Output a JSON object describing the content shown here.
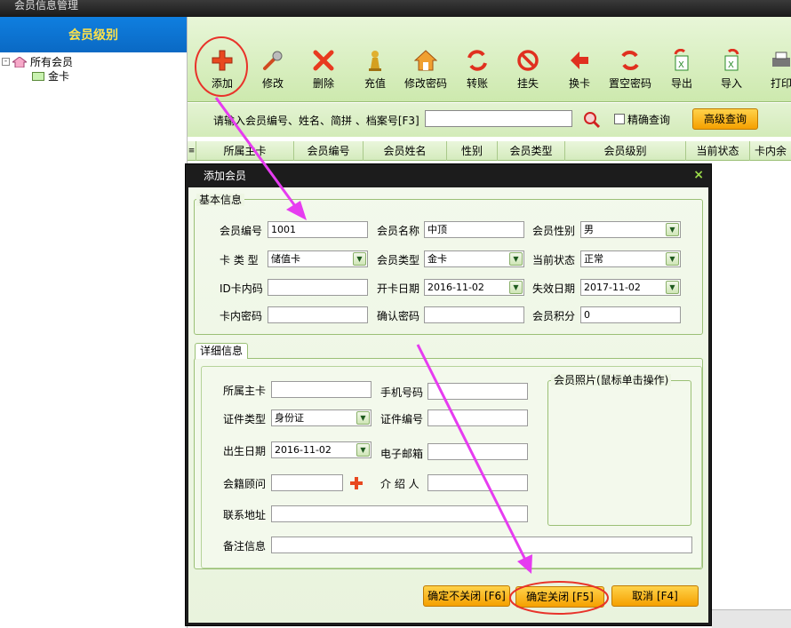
{
  "window": {
    "title": "会员信息管理"
  },
  "sidebar": {
    "header": "会员级别",
    "tree": [
      {
        "label": "所有会员",
        "expander": "-"
      },
      {
        "label": "金卡"
      }
    ]
  },
  "toolbar": {
    "buttons": [
      {
        "label": "添加",
        "icon": "plus-icon"
      },
      {
        "label": "修改",
        "icon": "wrench-icon"
      },
      {
        "label": "删除",
        "icon": "x-icon"
      },
      {
        "label": "充值",
        "icon": "pawn-icon"
      },
      {
        "label": "修改密码",
        "icon": "house-icon"
      },
      {
        "label": "转账",
        "icon": "transfer-icon"
      },
      {
        "label": "挂失",
        "icon": "ban-icon"
      },
      {
        "label": "换卡",
        "icon": "swap-icon"
      },
      {
        "label": "置空密码",
        "icon": "reset-icon"
      },
      {
        "label": "导出",
        "icon": "export-icon"
      },
      {
        "label": "导入",
        "icon": "import-icon"
      },
      {
        "label": "打印",
        "icon": "printer-icon"
      }
    ]
  },
  "search": {
    "label": "请输入会员编号、姓名、简拼 、档案号[F3]",
    "value": "",
    "exact_label": "精确查询",
    "advanced_label": "高级查询"
  },
  "grid": {
    "columns": [
      "所属主卡",
      "会员编号",
      "会员姓名",
      "性别",
      "会员类型",
      "会员级别",
      "当前状态",
      "卡内余"
    ]
  },
  "dialog": {
    "title": "添加会员",
    "close": "×",
    "basic": {
      "legend": "基本信息",
      "member_no_label": "会员编号",
      "member_no": "1001",
      "member_name_label": "会员名称",
      "member_name": "中顶",
      "gender_label": "会员性别",
      "gender": "男",
      "card_type_label": "卡 类 型",
      "card_type": "储值卡",
      "member_type_label": "会员类型",
      "member_type": "金卡",
      "status_label": "当前状态",
      "status": "正常",
      "id_code_label": "ID卡内码",
      "id_code": "",
      "open_date_label": "开卡日期",
      "open_date": "2016-11-02",
      "expire_label": "失效日期",
      "expire": "2017-11-02",
      "card_pwd_label": "卡内密码",
      "card_pwd": "",
      "confirm_pwd_label": "确认密码",
      "confirm_pwd": "",
      "points_label": "会员积分",
      "points": "0"
    },
    "detail": {
      "tab": "详细信息",
      "main_card_label": "所属主卡",
      "main_card": "",
      "phone_label": "手机号码",
      "phone": "",
      "id_type_label": "证件类型",
      "id_type": "身份证",
      "id_no_label": "证件编号",
      "id_no": "",
      "birth_label": "出生日期",
      "birth": "2016-11-02",
      "email_label": "电子邮箱",
      "email": "",
      "advisor_label": "会籍顾问",
      "advisor": "",
      "referrer_label": "介 绍 人",
      "referrer": "",
      "address_label": "联系地址",
      "address": "",
      "remark_label": "备注信息",
      "remark": "",
      "photo_legend": "会员照片(鼠标单击操作)"
    },
    "buttons": {
      "save_keep": "确定不关闭 [F6]",
      "save_close": "确定关闭 [F5]",
      "cancel": "取消 [F4]"
    }
  },
  "colors": {
    "accent": "#f5a000",
    "annotation": "#e63cf0",
    "circle": "#e8332a"
  }
}
